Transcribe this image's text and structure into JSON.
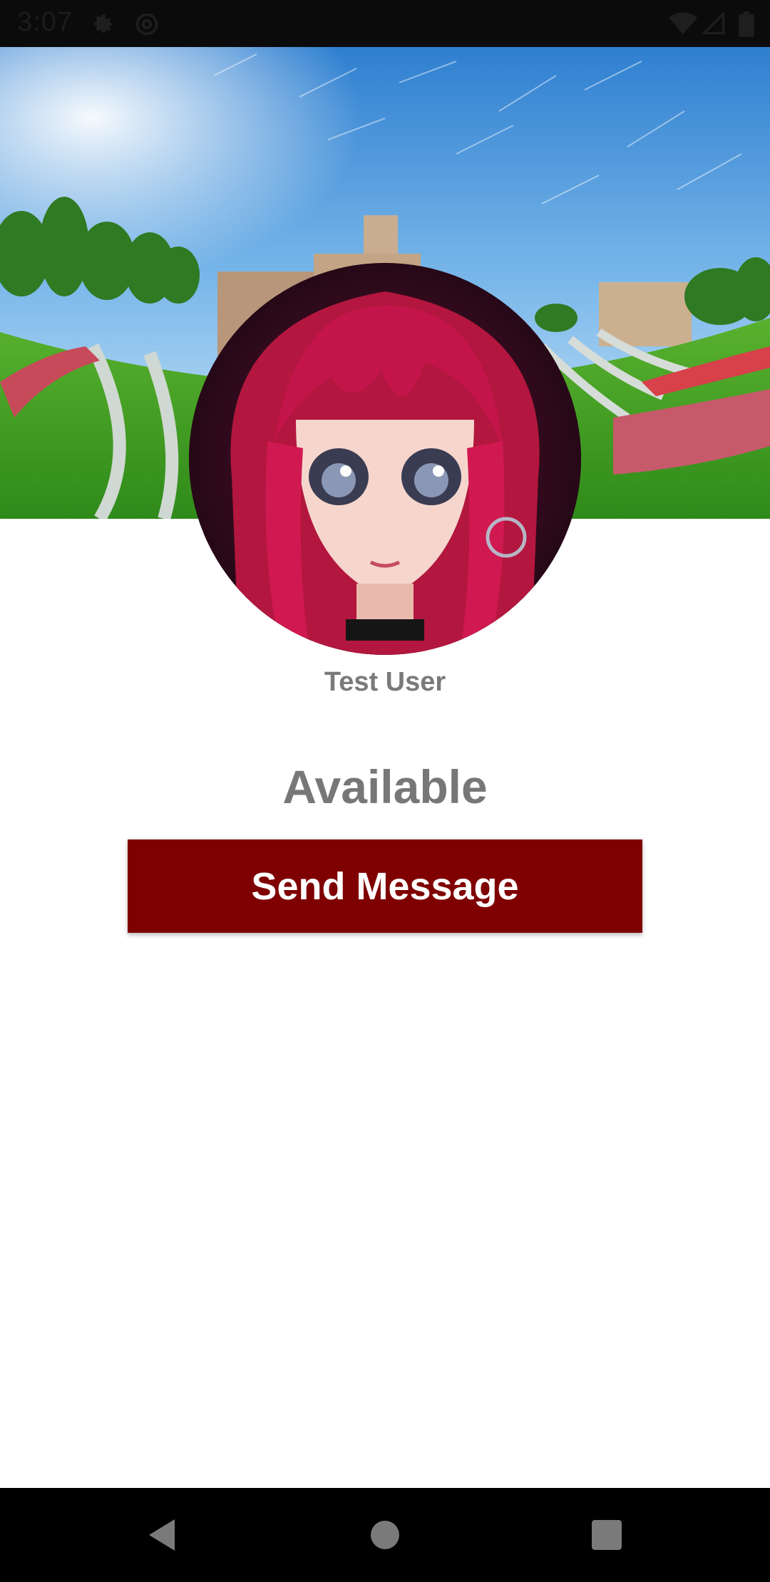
{
  "status_bar": {
    "time": "3:07",
    "icons": [
      "settings-icon",
      "at-sign-icon",
      "wifi-icon",
      "signal-icon",
      "battery-icon"
    ]
  },
  "profile": {
    "cover_image": "campus-amphitheater-photo",
    "avatar_image": "anime-girl-avatar",
    "name": "Test User",
    "status": "Available"
  },
  "actions": {
    "send_message_label": "Send Message"
  },
  "nav_bar": {
    "buttons": [
      "back-icon",
      "home-icon",
      "recents-icon"
    ]
  },
  "colors": {
    "accent": "#7f0000",
    "text_gray": "#777777",
    "status_bar": "#0b0b0b",
    "nav_bar": "#000000"
  }
}
